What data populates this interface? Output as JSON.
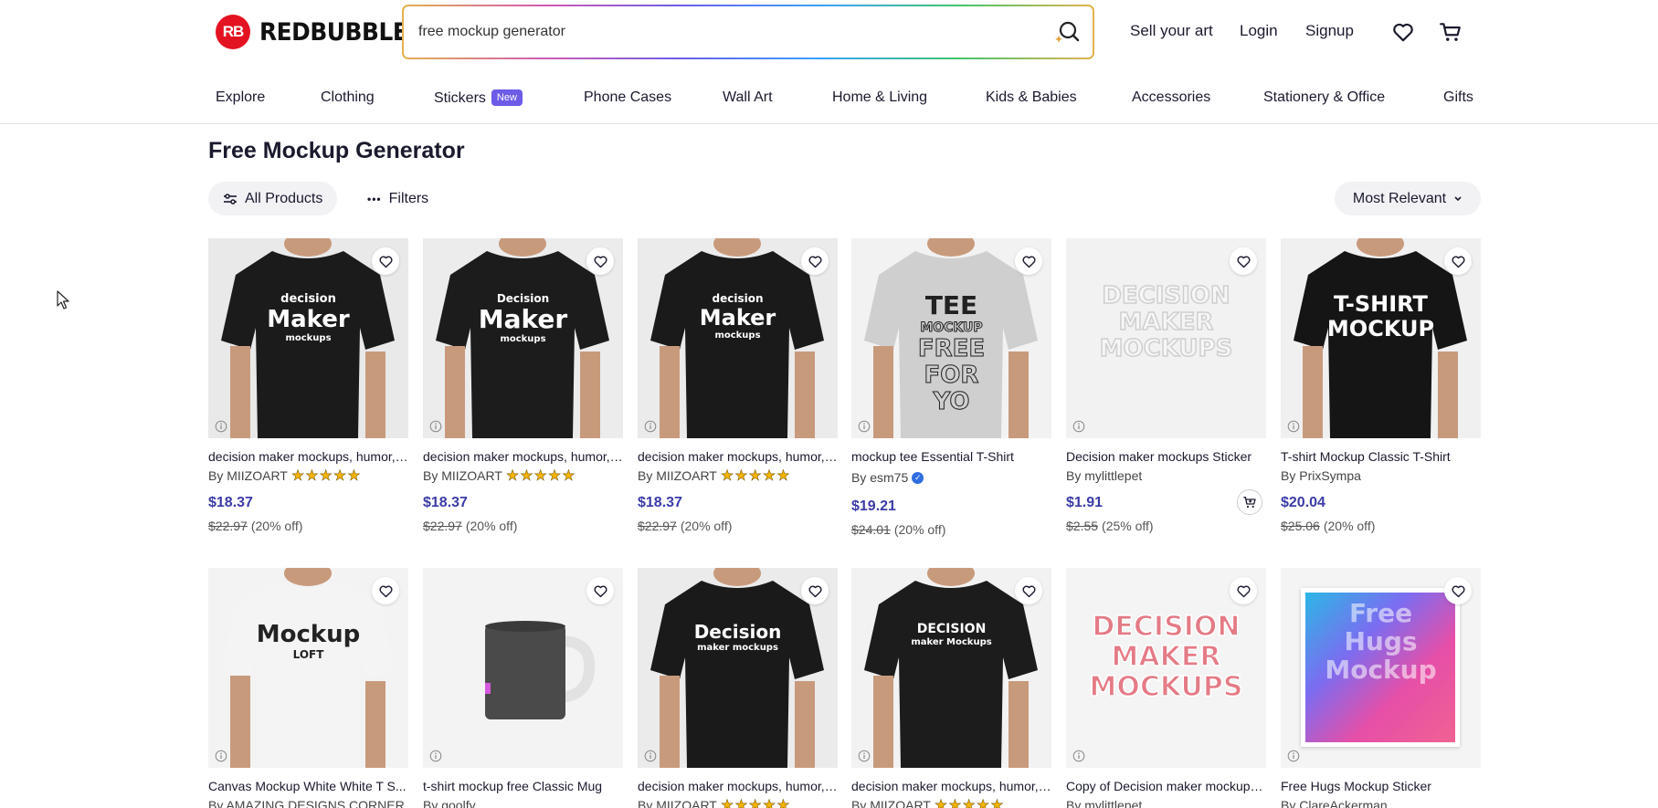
{
  "brand": {
    "logo_mark": "RB",
    "name": "REDBUBBLE"
  },
  "search": {
    "value": "free mockup generator"
  },
  "header": {
    "sell": "Sell your art",
    "login": "Login",
    "signup": "Signup"
  },
  "categories": [
    {
      "label": "Explore"
    },
    {
      "label": "Clothing"
    },
    {
      "label": "Stickers",
      "badge": "New"
    },
    {
      "label": "Phone Cases"
    },
    {
      "label": "Wall Art"
    },
    {
      "label": "Home & Living"
    },
    {
      "label": "Kids & Babies"
    },
    {
      "label": "Accessories"
    },
    {
      "label": "Stationery & Office"
    },
    {
      "label": "Gifts"
    }
  ],
  "page": {
    "title": "Free Mockup Generator"
  },
  "filters": {
    "all_products": "All Products",
    "filters": "Filters",
    "sort": "Most Relevant"
  },
  "colors": {
    "accent": "#3b3ba8",
    "brand": "#e41321",
    "badge": "#6c5ce7",
    "stars": "#f4b400"
  },
  "products": [
    {
      "title": "decision maker mockups, humor, ...",
      "by": "By MIIZOART",
      "stars": "★★★★★",
      "price": "$18.37",
      "orig": "$22.97",
      "discount": "(20% off)",
      "print_lines": [
        "decision",
        "Maker",
        "mockups"
      ]
    },
    {
      "title": "decision maker mockups, humor, ...",
      "by": "By MIIZOART",
      "stars": "★★★★★",
      "price": "$18.37",
      "orig": "$22.97",
      "discount": "(20% off)",
      "print_lines": [
        "Decision",
        "Maker",
        "mockups"
      ]
    },
    {
      "title": "decision maker mockups, humor, ...",
      "by": "By MIIZOART",
      "stars": "★★★★★",
      "price": "$18.37",
      "orig": "$22.97",
      "discount": "(20% off)",
      "print_lines": [
        "decision",
        "Maker",
        "mockups"
      ]
    },
    {
      "title": "mockup tee Essential T-Shirt",
      "by": "By esm75",
      "stars": "",
      "price": "$19.21",
      "orig": "$24.01",
      "discount": "(20% off)",
      "print_lines": [
        "TEE",
        "MOCKUP",
        "FREE",
        "FOR",
        "YO"
      ]
    },
    {
      "title": "Decision maker mockups Sticker",
      "by": "By mylittlepet",
      "stars": "",
      "price": "$1.91",
      "orig": "$2.55",
      "discount": "(25% off)",
      "print_lines": [
        "DECISION",
        "MAKER",
        "MOCKUPS"
      ]
    },
    {
      "title": "T-shirt Mockup Classic T-Shirt",
      "by": "By PrixSympa",
      "stars": "",
      "price": "$20.04",
      "orig": "$25.06",
      "discount": "(20% off)",
      "print_lines": [
        "T-SHIRT",
        "MOCKUP"
      ]
    },
    {
      "title": "Canvas Mockup White White T S...",
      "by": "By AMAZING DESIGNS CORNER",
      "print_lines": [
        "Mockup",
        "LOFT"
      ]
    },
    {
      "title": "t-shirt mockup free Classic Mug",
      "by": "By goolfy"
    },
    {
      "title": "decision maker mockups, humor, ...",
      "by": "By MIIZOART",
      "stars": "★★★★★",
      "print_lines": [
        "Decision",
        "maker mockups"
      ]
    },
    {
      "title": "decision maker mockups, humor, ...",
      "by": "By MIIZOART",
      "stars": "★★★★★",
      "print_lines": [
        "DECISION",
        "maker Mockups"
      ]
    },
    {
      "title": "Copy of Decision maker mockups...",
      "by": "By mylittlepet",
      "print_lines": [
        "DECISION",
        "MAKER",
        "MOCKUPS"
      ]
    },
    {
      "title": "Free Hugs Mockup Sticker",
      "by": "By ClareAckerman",
      "print_lines": [
        "Free",
        "Hugs",
        "Mockup"
      ]
    }
  ]
}
